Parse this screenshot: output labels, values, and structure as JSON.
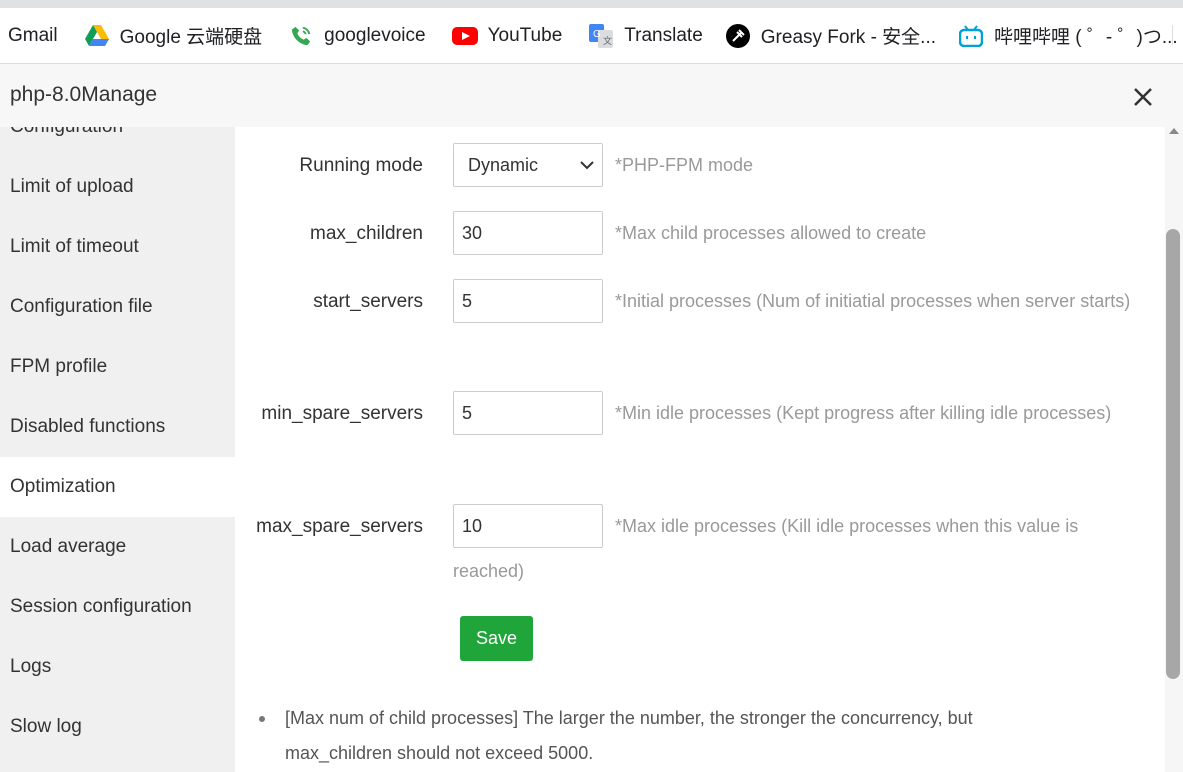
{
  "bookmarks": [
    {
      "label": "Gmail",
      "icon": "none"
    },
    {
      "label": "Google 云端硬盘",
      "icon": "google-drive-icon"
    },
    {
      "label": "googlevoice",
      "icon": "phone-icon"
    },
    {
      "label": "YouTube",
      "icon": "youtube-icon"
    },
    {
      "label": "Translate",
      "icon": "translate-icon"
    },
    {
      "label": "Greasy Fork - 安全...",
      "icon": "greasy-fork-icon"
    },
    {
      "label": "哔哩哔哩 ( ゜- ゜)つ...",
      "icon": "bilibili-icon"
    }
  ],
  "dialog": {
    "title": "php-8.0Manage",
    "close_icon": "close-icon"
  },
  "sidebar": {
    "items": [
      {
        "label": "Configuration"
      },
      {
        "label": "Limit of upload"
      },
      {
        "label": "Limit of timeout"
      },
      {
        "label": "Configuration file"
      },
      {
        "label": "FPM profile"
      },
      {
        "label": "Disabled functions"
      },
      {
        "label": "Optimization"
      },
      {
        "label": "Load average"
      },
      {
        "label": "Session configuration"
      },
      {
        "label": "Logs"
      },
      {
        "label": "Slow log"
      }
    ],
    "active": "Optimization"
  },
  "form": {
    "running_mode": {
      "label": "Running mode",
      "value": "Dynamic",
      "hint": "*PHP-FPM mode"
    },
    "max_children": {
      "label": "max_children",
      "value": "30",
      "hint": "*Max child processes allowed to create"
    },
    "start_servers": {
      "label": "start_servers",
      "value": "5",
      "hint": "*Initial processes (Num of initiatial processes when server starts)"
    },
    "min_spare_servers": {
      "label": "min_spare_servers",
      "value": "5",
      "hint": "*Min idle processes (Kept progress after killing idle processes)"
    },
    "max_spare_servers": {
      "label": "max_spare_servers",
      "value": "10",
      "hint": "*Max idle processes (Kill idle processes when this value is reached)"
    },
    "save_label": "Save"
  },
  "tips": [
    "[Max num of child processes] The larger the number, the stronger the concurrency, but max_children should not exceed 5000."
  ],
  "colors": {
    "accent": "#20a53a",
    "hint": "#999999",
    "sidebar_bg": "#f0f0f0"
  }
}
